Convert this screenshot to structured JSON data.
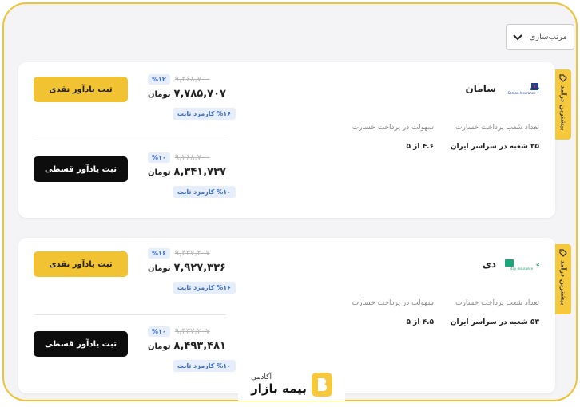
{
  "sort": {
    "label": "مرتب‌سازی",
    "icon": "chevron-down-icon"
  },
  "offers": [
    {
      "tag": "بیشترین درآمد",
      "insurer": {
        "name": "سامان",
        "logo_text": "بیمه سامان",
        "logo_sub": "Saman Insurance"
      },
      "stats": {
        "branches_label": "تعداد شعب پرداخت خسارت",
        "branches_value": "۳۵ شعبه در سراسر ایران",
        "ease_label": "سهولت در پرداخت خسارت",
        "ease_value": "۴.۶ از ۵"
      },
      "cash": {
        "discount": "%۱۲",
        "old_price": "۹,۲۶۸,۷۰۰",
        "new_price": "۷,۷۸۵,۷۰۷",
        "unit": "تومان",
        "fee": "%۱۶ کارمزد ثابت",
        "button": "ثبت یادآور نقدی"
      },
      "installment": {
        "discount": "%۱۰",
        "old_price": "۹,۲۶۸,۷۰۰",
        "new_price": "۸,۳۴۱,۷۳۷",
        "unit": "تومان",
        "fee": "%۱۰ کارمزد ثابت",
        "button": "ثبت یادآور قسطی"
      }
    },
    {
      "tag": "بیشترین درآمد",
      "insurer": {
        "name": "دی",
        "logo_text": "بیمه دی",
        "logo_sub": "day insurance"
      },
      "stats": {
        "branches_label": "تعداد شعب پرداخت خسارت",
        "branches_value": "۵۳ شعبه در سراسر ایران",
        "ease_label": "سهولت در پرداخت خسارت",
        "ease_value": "۴.۵ از ۵"
      },
      "cash": {
        "discount": "%۱۶",
        "old_price": "۹,۴۳۷,۲۰۷",
        "new_price": "۷,۹۲۷,۳۳۶",
        "unit": "تومان",
        "fee": "%۱۶ کارمزد ثابت",
        "button": "ثبت یادآور نقدی"
      },
      "installment": {
        "discount": "%۱۰",
        "old_price": "۹,۴۳۷,۲۰۷",
        "new_price": "۸,۴۹۳,۴۸۱",
        "unit": "تومان",
        "fee": "%۱۰ کارمزد ثابت",
        "button": "ثبت یادآور قسطی"
      }
    }
  ],
  "footer": {
    "small": "آکادمی",
    "big": "بیمه بازار"
  },
  "colors": {
    "accent": "#f1c232",
    "badge_bg": "#e6eefb",
    "badge_text": "#3d6fcf",
    "dark": "#0d0d0d"
  }
}
